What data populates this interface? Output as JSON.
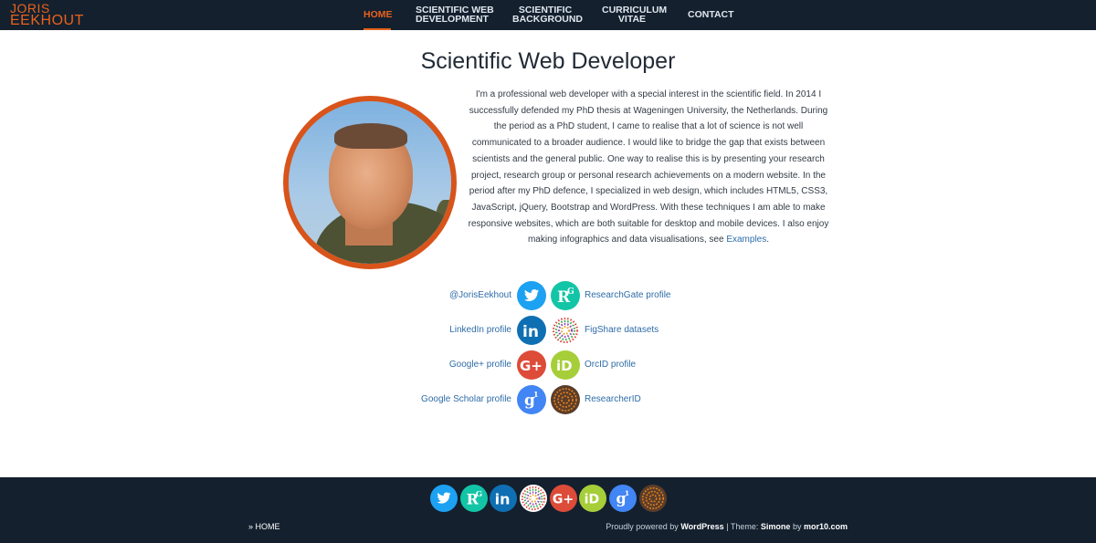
{
  "header": {
    "logo_line1": "JORIS",
    "logo_line2": "EEKHOUT",
    "nav": [
      {
        "line1": "HOME",
        "line2": ""
      },
      {
        "line1": "SCIENTIFIC WEB",
        "line2": "DEVELOPMENT"
      },
      {
        "line1": "SCIENTIFIC",
        "line2": "BACKGROUND"
      },
      {
        "line1": "CURRICULUM",
        "line2": "VITAE"
      },
      {
        "line1": "CONTACT",
        "line2": ""
      }
    ],
    "active_nav": "HOME"
  },
  "main": {
    "title": "Scientific Web Developer",
    "intro_text": "I'm a professional web developer with a special interest in the scientific field. In 2014 I successfully defended my PhD thesis at Wageningen University, the Netherlands. During the period as a PhD student, I came to realise that a lot of science is not well communicated to a broader audience. I would like to bridge the gap that exists between scientists and the general public. One way to realise this is by presenting your research project, research group or personal research achievements on a modern website. In the period after my PhD defence, I specialized in web design, which includes HTML5, CSS3, JavaScript, jQuery, Bootstrap and WordPress. With these techniques I am able to make responsive websites, which are both suitable for desktop and mobile devices. I also enjoy making infographics and data visualisations, see ",
    "intro_link": "Examples",
    "intro_end": ".",
    "profiles_left": [
      {
        "label": "@JorisEekhout",
        "icon": "twitter-icon"
      },
      {
        "label": "LinkedIn profile",
        "icon": "linkedin-icon"
      },
      {
        "label": "Google+ profile",
        "icon": "googleplus-icon"
      },
      {
        "label": "Google Scholar profile",
        "icon": "google-scholar-icon"
      }
    ],
    "profiles_right": [
      {
        "label": "ResearchGate profile",
        "icon": "researchgate-icon"
      },
      {
        "label": "FigShare datasets",
        "icon": "figshare-icon"
      },
      {
        "label": "OrcID profile",
        "icon": "orcid-icon"
      },
      {
        "label": "ResearcherID",
        "icon": "researcherid-icon"
      }
    ]
  },
  "footer": {
    "breadcrumb_prefix": "»",
    "breadcrumb_home": "HOME",
    "credit_prefix": "Proudly powered by",
    "credit_wp": "WordPress",
    "credit_sep": "| Theme:",
    "credit_theme": "Simone",
    "credit_by": "by",
    "credit_author": "mor10.com"
  },
  "colors": {
    "header_bg": "#14202e",
    "accent": "#e8621c",
    "link": "#2e6ca8"
  }
}
